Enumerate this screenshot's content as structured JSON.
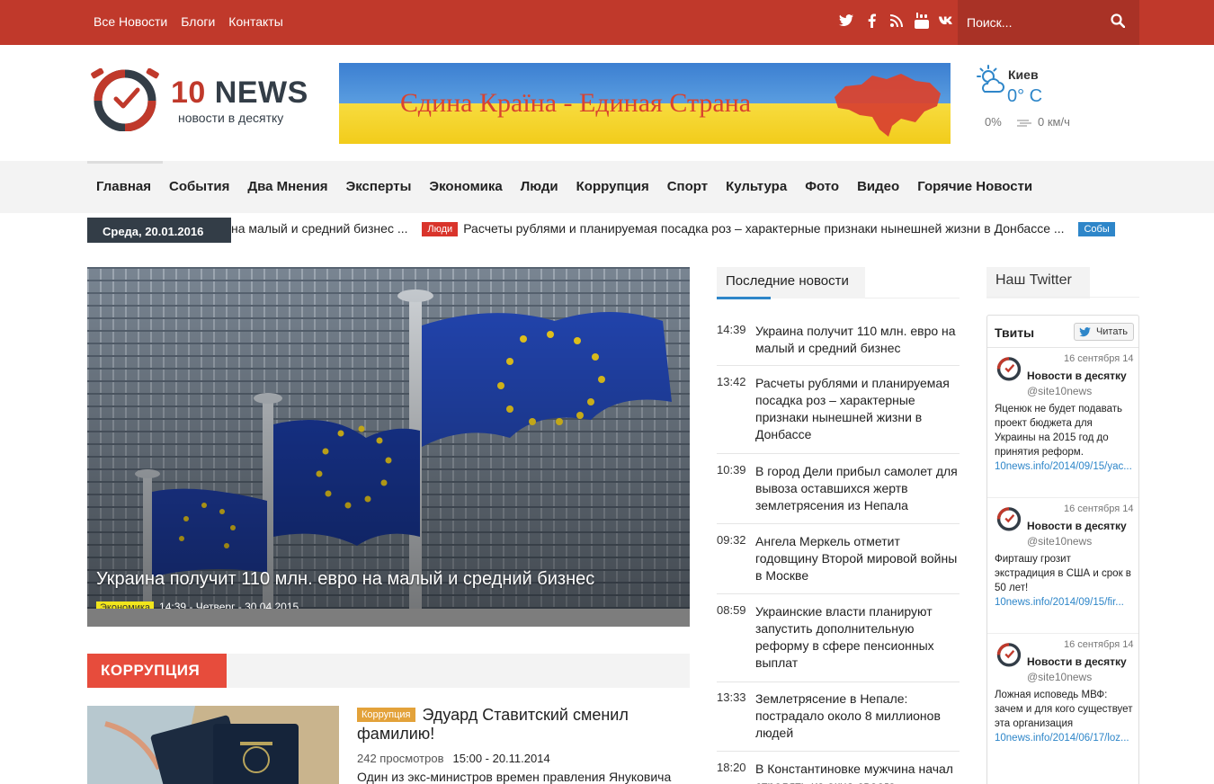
{
  "topbar": {
    "nav": [
      "Все Новости",
      "Блоги",
      "Контакты"
    ],
    "social_icons": [
      "twitter-icon",
      "facebook-icon",
      "rss-icon",
      "youtube-icon",
      "vk-icon"
    ],
    "search_placeholder": "Поиск..."
  },
  "logo": {
    "brand_number": "10",
    "brand_word": "NEWS",
    "tagline": "новости в десятку"
  },
  "banner": {
    "text": "Єдина Країна - Единая Страна"
  },
  "weather": {
    "city": "Киев",
    "temp": "0° C",
    "humidity": "0%",
    "wind": "0 км/ч"
  },
  "mainnav": [
    "Главная",
    "События",
    "Два Мнения",
    "Эксперты",
    "Экономика",
    "Люди",
    "Коррупция",
    "Спорт",
    "Культура",
    "Фото",
    "Видео",
    "Горячие Новости"
  ],
  "ticker": {
    "date": "Среда, 20.01.2016",
    "items": [
      {
        "category": "",
        "text": "на малый и средний бизнес ..."
      },
      {
        "category": "Люди",
        "text": "Расчеты рублями и планируемая посадка роз – характерные признаки нынешней жизни в Донбассе ..."
      },
      {
        "category": "Собы",
        "text": ""
      }
    ]
  },
  "hero": {
    "title": "Украина получит 110 млн. евро на малый и средний бизнес",
    "category": "Экономика",
    "meta": "14:39 - Четверг - 30.04.2015"
  },
  "section": {
    "label": "КОРРУПЦИЯ",
    "article": {
      "category": "Коррупция",
      "title": "Эдуард Ставитский сменил фамилию!",
      "views": "242 просмотров",
      "time": "15:00 - 20.11.2014",
      "excerpt": "Один из экс-министров времен правления Януковича"
    }
  },
  "latest": {
    "header": "Последние новости",
    "items": [
      {
        "time": "14:39",
        "text": "Украина получит 110 млн. евро на малый и средний бизнес"
      },
      {
        "time": "13:42",
        "text": "Расчеты рублями и планируемая посадка роз – характерные признаки нынешней жизни в Донбассе"
      },
      {
        "time": "10:39",
        "text": "В город Дели прибыл самолет для вывоза оставшихся жертв землетрясения из Непала"
      },
      {
        "time": "09:32",
        "text": "Ангела Меркель отметит годовщину Второй мировой войны в Москве"
      },
      {
        "time": "08:59",
        "text": "Украинские власти планируют запустить дополнительную реформу в сфере пенсионных выплат"
      },
      {
        "time": "13:33",
        "text": "Землетрясение в Непале: пострадало около 8 миллионов людей"
      },
      {
        "time": "18:20",
        "text": "В Константиновке мужчина начал стрелять из окна своего"
      }
    ]
  },
  "twitter": {
    "header": "Наш Twitter",
    "box_title": "Твиты",
    "follow": "Читать",
    "tweets": [
      {
        "date": "16 сентября 14",
        "name": "Новости в десятку",
        "handle": "@site10news",
        "body": "Яценюк не будет подавать проект бюджета для Украины на 2015 год до принятия реформ.",
        "link": "10news.info/2014/09/15/yac..."
      },
      {
        "date": "16 сентября 14",
        "name": "Новости в десятку",
        "handle": "@site10news",
        "body": "Фирташу грозит экстрадиция в США и срок в 50 лет!",
        "link": "10news.info/2014/09/15/fir..."
      },
      {
        "date": "16 сентября 14",
        "name": "Новости в десятку",
        "handle": "@site10news",
        "body": "Ложная исповедь МВФ: зачем и для кого существует эта организация",
        "link": "10news.info/2014/06/17/loz..."
      }
    ]
  },
  "colors": {
    "brand_red": "#c0392b",
    "accent_blue": "#2e86c9",
    "dark": "#333d47",
    "section_red": "#e74c3c"
  }
}
